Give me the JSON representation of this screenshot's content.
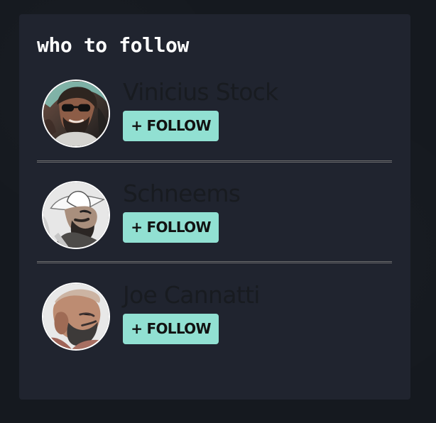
{
  "widget": {
    "title": "who to follow"
  },
  "users": [
    {
      "name": "Vinicius Stock",
      "follow_label": "+ FOLLOW"
    },
    {
      "name": "Schneems",
      "follow_label": "+ FOLLOW"
    },
    {
      "name": "Joe Cannatti",
      "follow_label": "+ FOLLOW"
    }
  ],
  "colors": {
    "page_background": "#15191f",
    "card_background": "#20242f",
    "button_background": "#91e0d2",
    "button_text": "#111111",
    "title_text": "#ffffff",
    "name_text": "#181b20"
  },
  "icons": {
    "avatars": [
      "user-avatar-photo",
      "user-avatar-photo",
      "user-avatar-photo"
    ]
  }
}
